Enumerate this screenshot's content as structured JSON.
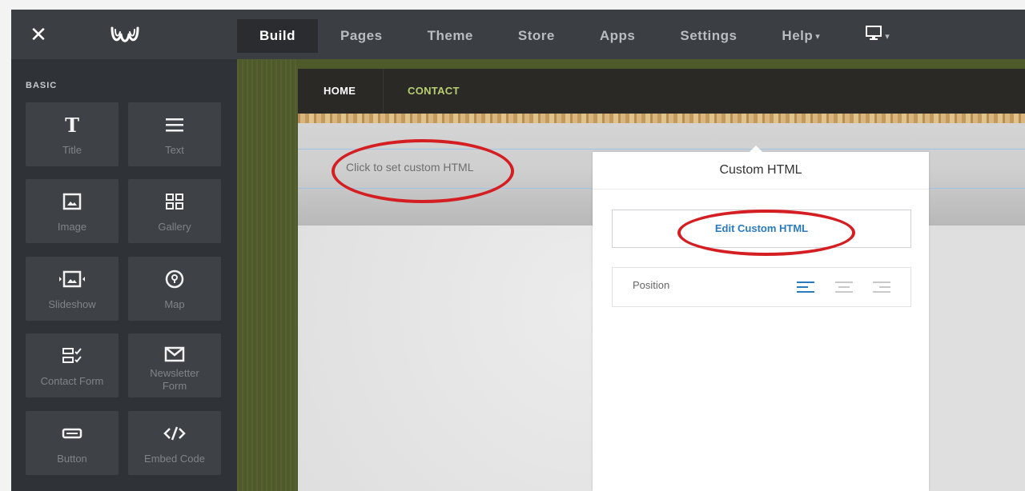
{
  "topbar": {
    "close_icon": "close-icon",
    "logo_icon": "weebly-logo-icon",
    "nav": [
      {
        "label": "Build",
        "active": true
      },
      {
        "label": "Pages",
        "active": false
      },
      {
        "label": "Theme",
        "active": false
      },
      {
        "label": "Store",
        "active": false
      },
      {
        "label": "Apps",
        "active": false
      },
      {
        "label": "Settings",
        "active": false
      },
      {
        "label": "Help",
        "active": false,
        "caret": "▾"
      }
    ],
    "device_icon": "monitor-icon",
    "device_caret": "▾"
  },
  "sidebar": {
    "section_title": "BASIC",
    "tiles": [
      {
        "label": "Title",
        "icon": "title-icon"
      },
      {
        "label": "Text",
        "icon": "text-lines-icon"
      },
      {
        "label": "Image",
        "icon": "image-icon"
      },
      {
        "label": "Gallery",
        "icon": "gallery-grid-icon"
      },
      {
        "label": "Slideshow",
        "icon": "slideshow-icon"
      },
      {
        "label": "Map",
        "icon": "map-pin-icon"
      },
      {
        "label": "Contact Form",
        "icon": "contact-form-icon"
      },
      {
        "label_line1": "Newsletter",
        "label_line2": "Form",
        "icon": "envelope-icon"
      },
      {
        "label": "Button",
        "icon": "button-icon"
      },
      {
        "label": "Embed Code",
        "icon": "code-icon"
      }
    ]
  },
  "site": {
    "nav": [
      {
        "label": "HOME"
      },
      {
        "label": "CONTACT"
      }
    ],
    "placeholder": "Click to set custom HTML"
  },
  "panel": {
    "title": "Custom HTML",
    "edit_button": "Edit Custom HTML",
    "position_label": "Position",
    "align_icons": [
      "align-left-icon",
      "align-center-icon",
      "align-right-icon"
    ],
    "active_color": "#2a7bbd"
  },
  "colors": {
    "annotation_red": "#d41e22",
    "contact_green": "#b7cf72"
  }
}
